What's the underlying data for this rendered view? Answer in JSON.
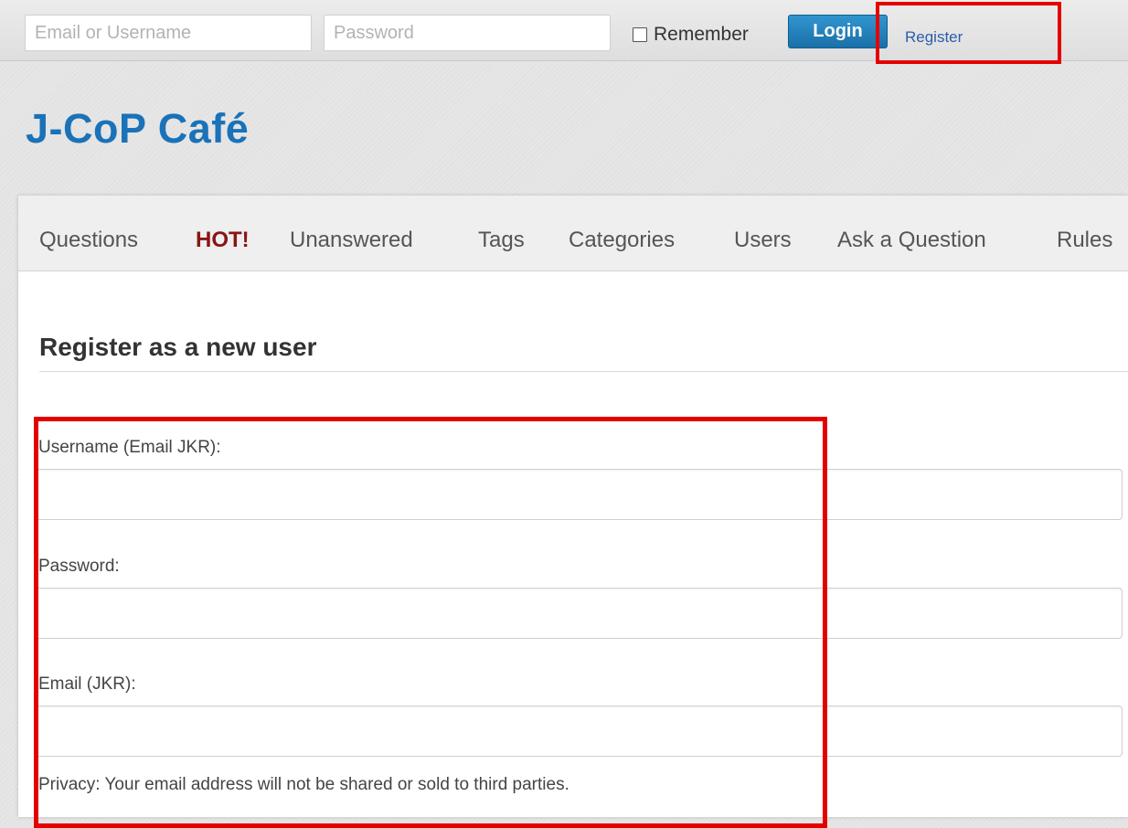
{
  "topbar": {
    "username_placeholder": "Email or Username",
    "password_placeholder": "Password",
    "remember_label": "Remember",
    "login_label": "Login",
    "register_label": "Register"
  },
  "site": {
    "title": "J-CoP Café"
  },
  "nav": {
    "items": [
      {
        "label": "Questions"
      },
      {
        "label": "HOT!"
      },
      {
        "label": "Unanswered"
      },
      {
        "label": "Tags"
      },
      {
        "label": "Categories"
      },
      {
        "label": "Users"
      },
      {
        "label": "Ask a Question"
      },
      {
        "label": "Rules"
      }
    ]
  },
  "page": {
    "heading": "Register as a new user"
  },
  "form": {
    "username_label": "Username (Email JKR):",
    "username_value": "",
    "password_label": "Password:",
    "password_value": "",
    "email_label": "Email (JKR):",
    "email_value": "",
    "privacy_note": "Privacy: Your email address will not be shared or sold to third parties."
  },
  "colors": {
    "brand": "#1a72b8",
    "hot": "#8a1414",
    "login_button": "#1a70a8",
    "highlight": "#e50000"
  }
}
